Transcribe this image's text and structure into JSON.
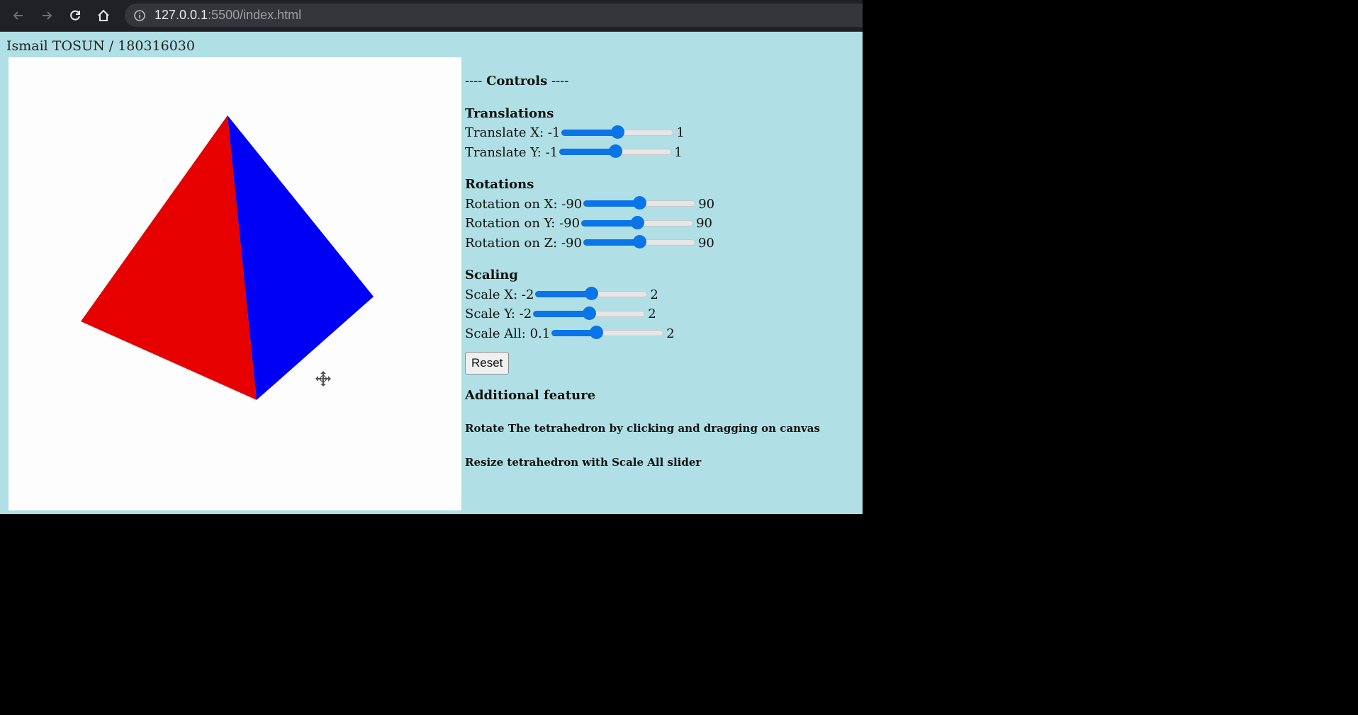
{
  "browser": {
    "url_host": "127.0.0.1",
    "url_path": ":5500/index.html"
  },
  "page": {
    "student": "Ismail TOSUN / 180316030"
  },
  "controls": {
    "title_prefix": "---- ",
    "title": "Controls",
    "title_suffix": " ----",
    "translations": {
      "heading": "Translations",
      "x": {
        "label": "Translate X: -1",
        "max": "1",
        "fraction": 0.5
      },
      "y": {
        "label": "Translate Y: -1",
        "max": "1",
        "fraction": 0.5
      }
    },
    "rotations": {
      "heading": "Rotations",
      "x": {
        "label": "Rotation on X: -90",
        "max": "90",
        "fraction": 0.5
      },
      "y": {
        "label": "Rotation on Y: -90",
        "max": "90",
        "fraction": 0.5
      },
      "z": {
        "label": "Rotation on Z: -90",
        "max": "90",
        "fraction": 0.5
      }
    },
    "scaling": {
      "heading": "Scaling",
      "x": {
        "label": "Scale X: -2",
        "max": "2",
        "fraction": 0.5
      },
      "y": {
        "label": "Scale Y: -2",
        "max": "2",
        "fraction": 0.5
      },
      "all": {
        "label": "Scale All: 0.1",
        "max": "2",
        "fraction": 0.4
      }
    },
    "reset_label": "Reset",
    "feature_heading": "Additional feature",
    "feature_1": "Rotate The tetrahedron by clicking and dragging on canvas",
    "feature_2": "Resize tetrahedron with Scale All slider"
  },
  "colors": {
    "page_bg": "#b0e0e6",
    "face_left": "#e60000",
    "face_right": "#0000f5",
    "slider_accent": "#0a74e8"
  },
  "icons": [
    "back-arrow-icon",
    "forward-arrow-icon",
    "reload-icon",
    "home-icon",
    "info-icon",
    "move-cursor-icon"
  ]
}
